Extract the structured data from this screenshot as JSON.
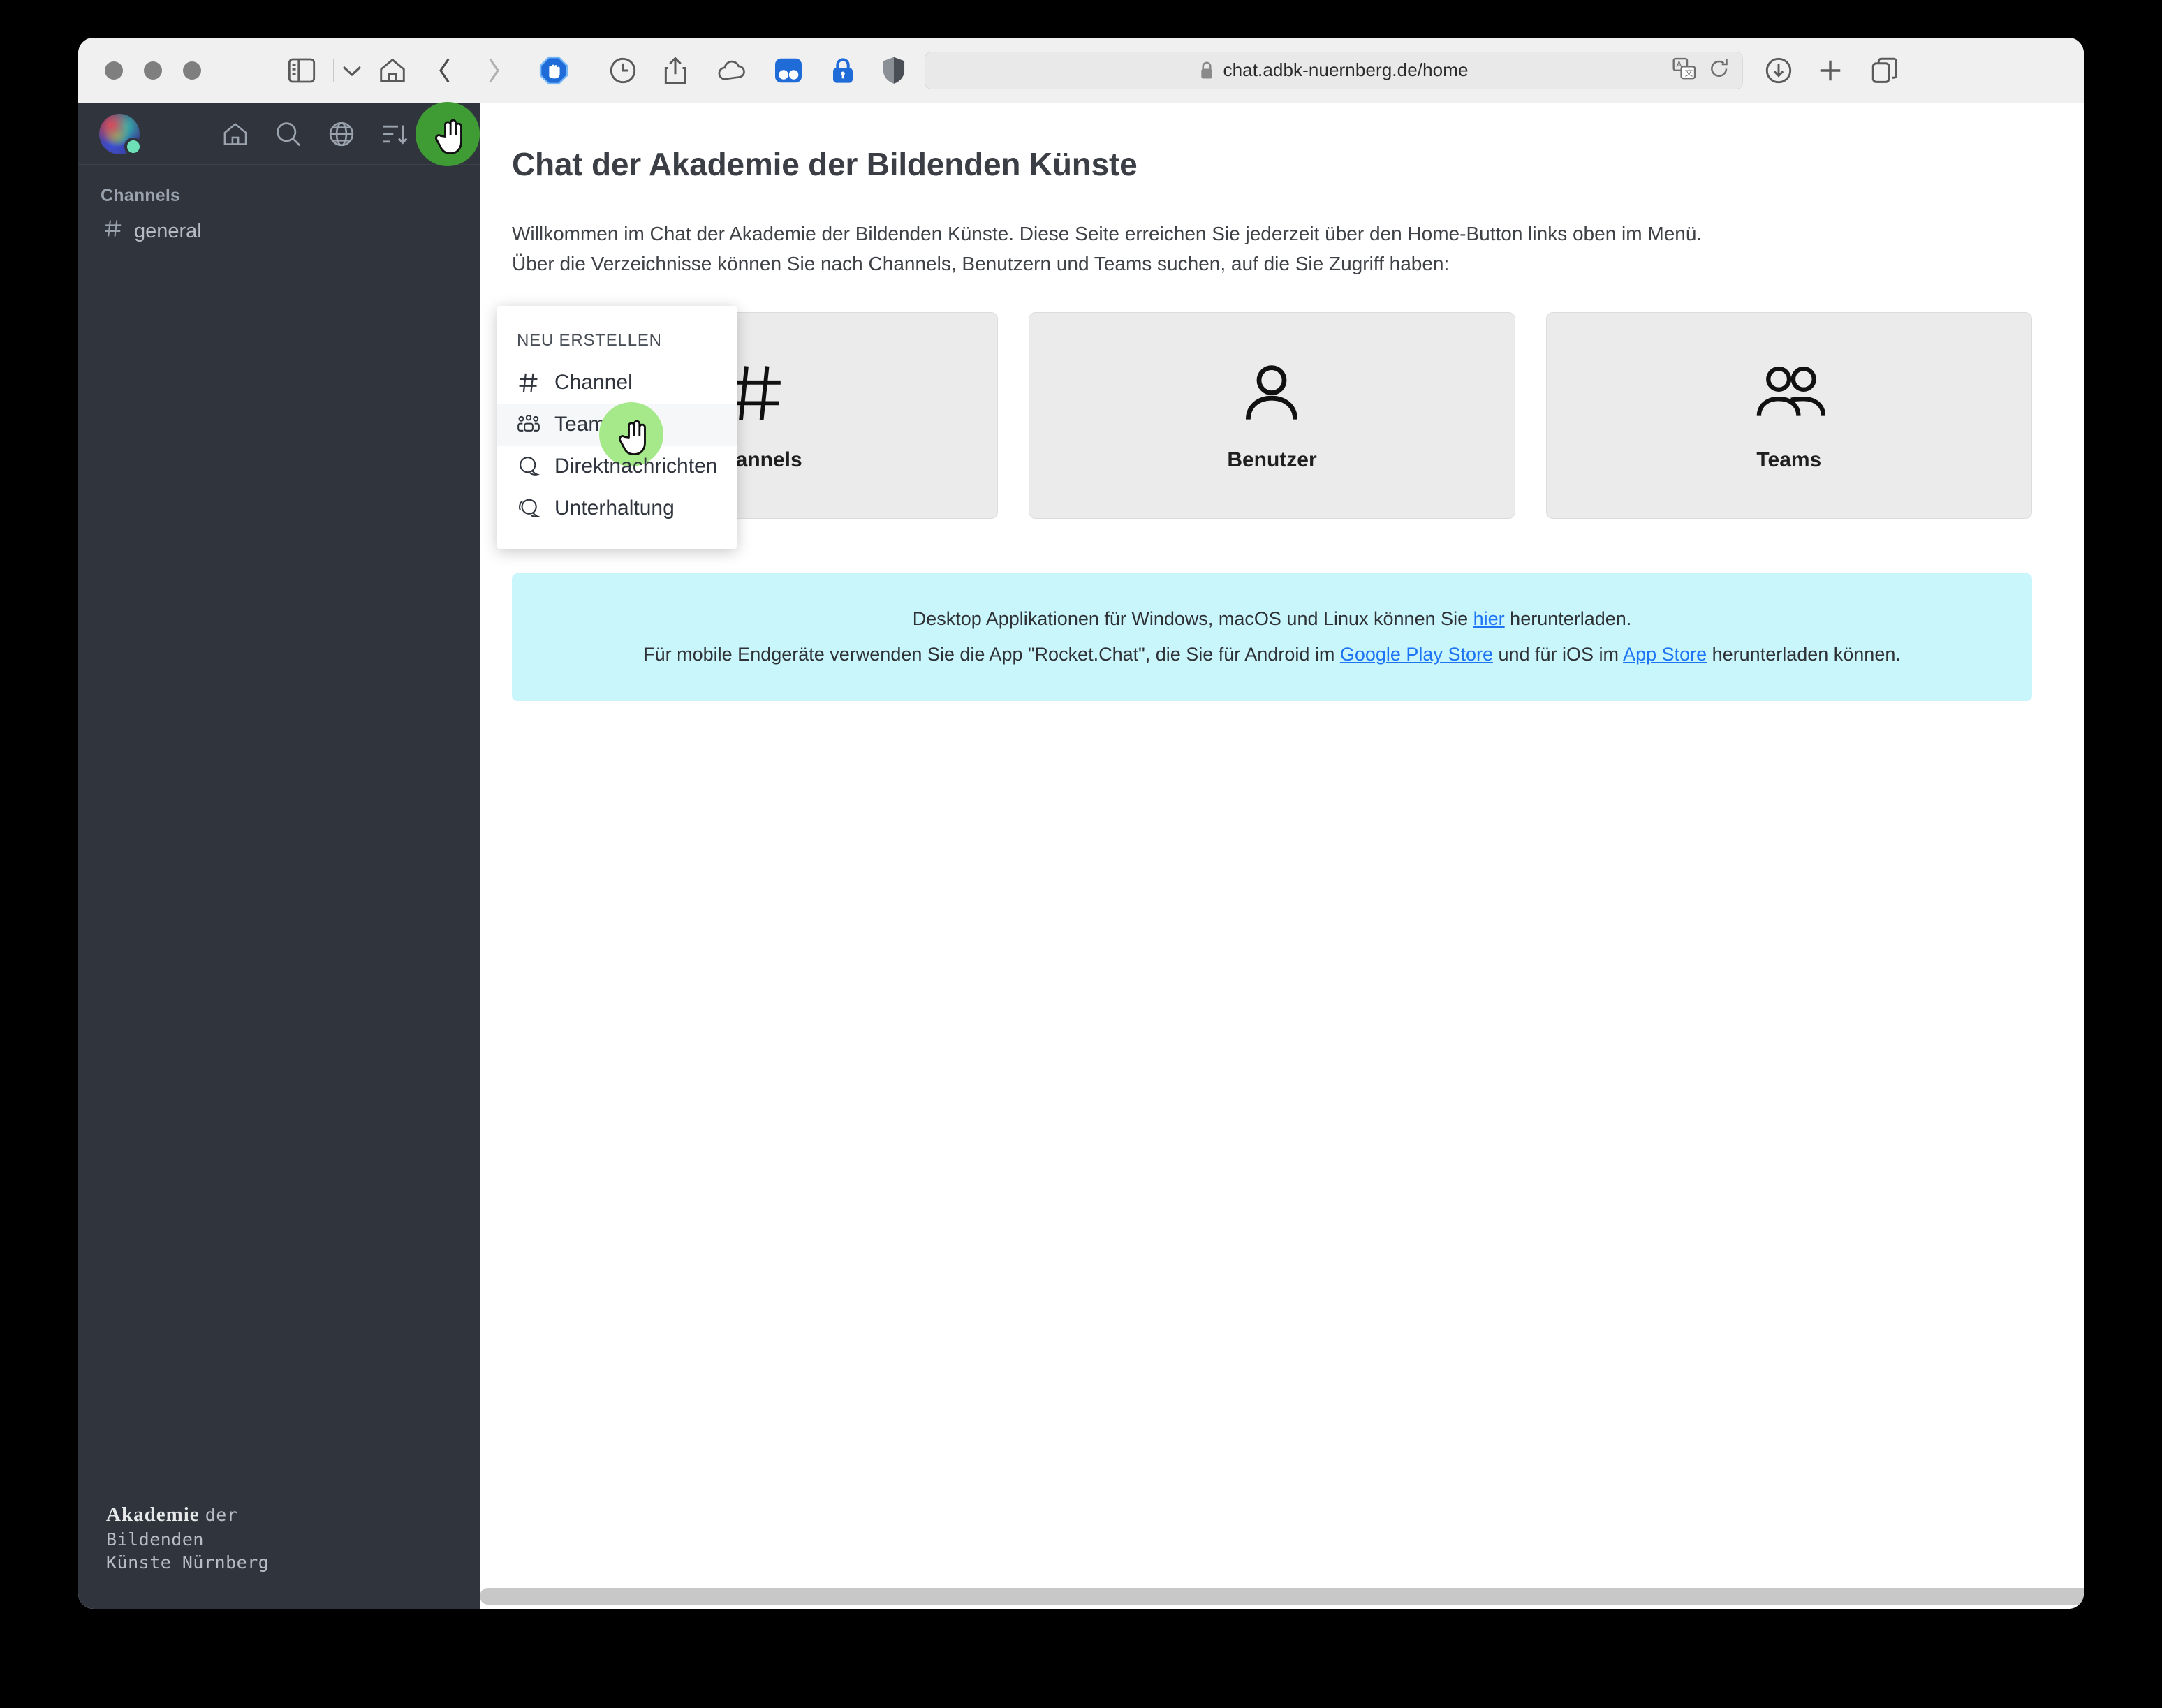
{
  "browser": {
    "url": "chat.adbk-nuernberg.de/home",
    "lock_icon": "lock-icon",
    "traffic_lights": [
      "close",
      "minimize",
      "zoom"
    ],
    "toolbar_icons": [
      "sidebar-toggle-icon",
      "chevron-down-icon",
      "home-icon",
      "back-icon",
      "forward-icon",
      "adblock-icon",
      "history-clock-icon",
      "share-icon",
      "cloud-icon",
      "extension-dots-icon",
      "password-lock-icon",
      "shield-icon"
    ],
    "url_right_icons": [
      "translate-icon",
      "reload-icon"
    ],
    "trailing_icons": [
      "downloads-icon",
      "new-tab-icon",
      "tab-overview-icon"
    ]
  },
  "sidebar": {
    "avatar": {
      "name": "user-avatar",
      "status": "online"
    },
    "header_icons": [
      {
        "name": "home-icon",
        "label": "Home"
      },
      {
        "name": "search-icon",
        "label": "Suchen"
      },
      {
        "name": "directory-globe-icon",
        "label": "Verzeichnis"
      },
      {
        "name": "sort-icon",
        "label": "Sortieren"
      },
      {
        "name": "create-new-icon",
        "label": "Neu erstellen"
      }
    ],
    "section_label": "Channels",
    "channels": [
      {
        "icon": "hash-icon",
        "name": "general"
      }
    ],
    "footer_logo": {
      "line1_bold": "Akademie",
      "line1_rest": "der",
      "line2": "Bildenden",
      "line3": "Künste Nürnberg"
    }
  },
  "create_menu": {
    "title": "NEU ERSTELLEN",
    "items": [
      {
        "label": "Channel",
        "icon": "hash-icon",
        "active": false
      },
      {
        "label": "Team",
        "icon": "team-icon",
        "active": true
      },
      {
        "label": "Direktnachrichten",
        "icon": "balloon-icon",
        "active": false
      },
      {
        "label": "Unterhaltung",
        "icon": "discussion-icon",
        "active": false
      }
    ]
  },
  "main": {
    "title": "Chat der Akademie der Bildenden Künste",
    "intro_line1": "Willkommen im Chat der Akademie der Bildenden Künste. Diese Seite erreichen Sie jederzeit über den Home-Button links oben im Menü.",
    "intro_line2": "Über die Verzeichnisse können Sie nach Channels, Benutzern und Teams suchen, auf die Sie Zugriff haben:",
    "cards": [
      {
        "label": "Channels",
        "icon": "hash-icon"
      },
      {
        "label": "Benutzer",
        "icon": "user-icon"
      },
      {
        "label": "Teams",
        "icon": "users-group-icon"
      }
    ],
    "banner": {
      "line1_pre": "Desktop Applikationen für Windows, macOS und Linux können Sie ",
      "line1_link": "hier",
      "line1_post": " herunterladen.",
      "line2_pre": "Für mobile Endgeräte verwenden Sie die App \"Rocket.Chat\", die Sie für Android im ",
      "line2_link1": "Google Play Store",
      "line2_mid": " und für iOS im ",
      "line2_link2": "App Store",
      "line2_post": " herunterladen können."
    }
  },
  "colors": {
    "sidebar_bg": "#2f343d",
    "cursor_highlight_light": "#a6e98a",
    "cursor_highlight_dark": "#3f9c35",
    "banner_bg": "#c9f6fb",
    "link": "#1d74f5",
    "card_bg": "#ebebeb"
  }
}
